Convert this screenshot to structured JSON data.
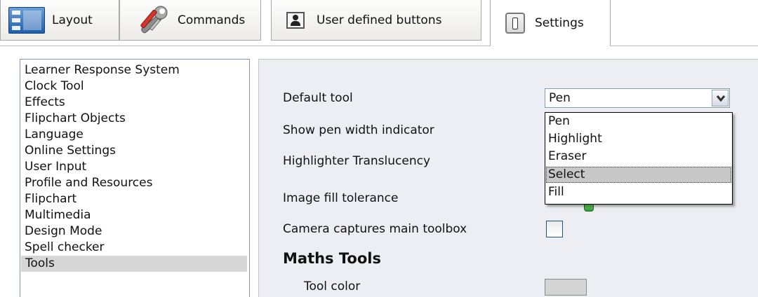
{
  "tabs": [
    {
      "label": "Layout",
      "icon": "layout-icon",
      "active": false
    },
    {
      "label": "Commands",
      "icon": "wrench-screwdriver-icon",
      "active": false
    },
    {
      "label": "User defined buttons",
      "icon": "portrait-icon",
      "active": false
    },
    {
      "label": "Settings",
      "icon": "settings-icon",
      "active": true
    }
  ],
  "categories": {
    "items": [
      "Learner Response System",
      "Clock Tool",
      "Effects",
      "Flipchart Objects",
      "Language",
      "Online Settings",
      "User Input",
      "Profile and Resources",
      "Flipchart",
      "Multimedia",
      "Design Mode",
      "Spell checker",
      "Tools"
    ],
    "selected": "Tools"
  },
  "settings": {
    "default_tool": {
      "label": "Default tool",
      "value": "Pen",
      "options": [
        "Pen",
        "Highlight",
        "Eraser",
        "Select",
        "Fill"
      ],
      "highlighted_option": "Select"
    },
    "show_pen_width": {
      "label": "Show pen width indicator"
    },
    "highlighter_translucency": {
      "label": "Highlighter Translucency"
    },
    "image_fill_tolerance": {
      "label": "Image fill tolerance"
    },
    "camera_captures": {
      "label": "Camera captures main toolbox",
      "checked": false
    },
    "maths_section": {
      "title": "Maths Tools"
    },
    "tool_color": {
      "label": "Tool color",
      "color": "#d4d4d4"
    }
  },
  "colors": {
    "panel_background": "#eceef3",
    "selection": "#d6d6d6",
    "border": "#7f9db9",
    "slider_thumb": "#3aa83a"
  }
}
